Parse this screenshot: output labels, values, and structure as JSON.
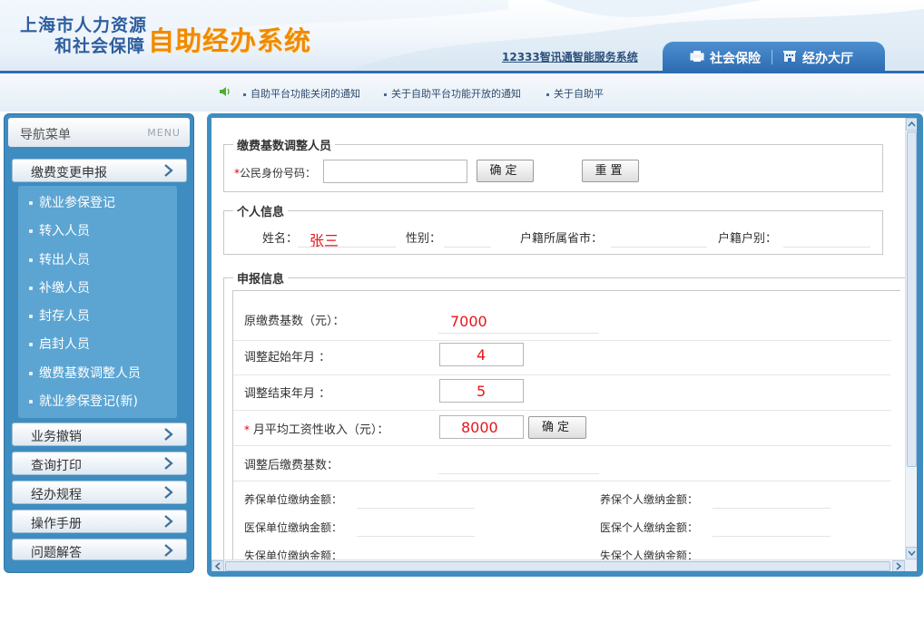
{
  "header": {
    "logo_line1": "上海市人力资源",
    "logo_line2": "和社会保障",
    "system_name": "自助经办系统",
    "top_link": "12333智讯通智能服务系统",
    "tabs": [
      {
        "label": "社会保险",
        "icon": "printer-icon"
      },
      {
        "label": "经办大厅",
        "icon": "building-icon"
      }
    ]
  },
  "notices": [
    "自助平台功能关闭的通知",
    "关于自助平台功能开放的通知",
    "关于自助平"
  ],
  "sidebar": {
    "title": "导航菜单",
    "title_en": "MENU",
    "active_menu": "缴费变更申报",
    "sub_items": [
      "就业参保登记",
      "转入人员",
      "转出人员",
      "补缴人员",
      "封存人员",
      "启封人员",
      "缴费基数调整人员",
      "就业参保登记(新)"
    ],
    "menus": [
      "业务撤销",
      "查询打印",
      "经办规程",
      "操作手册",
      "问题解答"
    ]
  },
  "form": {
    "section1_title": "缴费基数调整人员",
    "id_label": "公民身份号码：",
    "id_value": "",
    "confirm_label": "确定",
    "reset_label": "重置",
    "section2_title": "个人信息",
    "name_label": "姓名：",
    "name_value": "张三",
    "gender_label": "性别：",
    "province_label": "户籍所属省市：",
    "hukou_label": "户籍户别：",
    "section3_title": "申报信息",
    "orig_base_label": "原缴费基数（元）：",
    "orig_base_value": "7000",
    "start_label": "调整起始年月 ：",
    "start_value": "4",
    "end_label": "调整结束年月 ：",
    "end_value": "5",
    "income_label": "月平均工资性收入（元）：",
    "income_value": "8000",
    "income_confirm": "确定",
    "new_base_label": "调整后缴费基数：",
    "pension_unit_label": "养保单位缴纳金额：",
    "pension_person_label": "养保个人缴纳金额：",
    "medical_unit_label": "医保单位缴纳金额：",
    "medical_person_label": "医保个人缴纳金额：",
    "unemp_unit_label": "失保单位缴纳金额：",
    "unemp_person_label": "失保个人缴纳金额："
  }
}
